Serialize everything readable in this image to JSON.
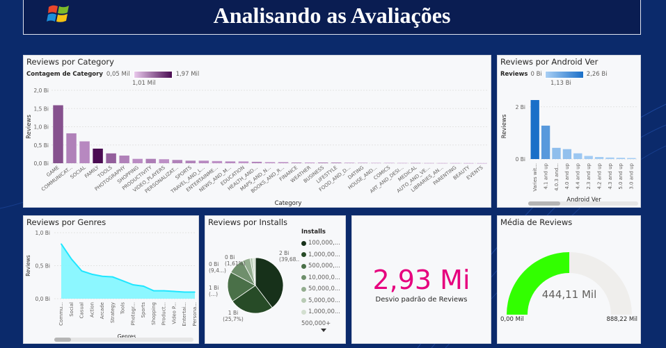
{
  "header": {
    "title": "Analisando as Avaliações"
  },
  "category_card": {
    "title": "Reviews por Category",
    "legend_label": "Contagem de Category",
    "legend_min": "0,05 Mil",
    "legend_max": "1,97 Mil",
    "legend_mid": "1,01 Mil",
    "x_title": "Category",
    "y_title": "Reviews"
  },
  "android_card": {
    "title": "Reviews por Android Ver",
    "legend_label": "Reviews",
    "legend_min": "0 Bi",
    "legend_max": "2,26 Bi",
    "legend_mid": "1,13 Bi",
    "x_title": "Android Ver",
    "y_title": "Reviews"
  },
  "genres_card": {
    "title": "Reviews por Genres",
    "x_title": "Genres",
    "y_title": "Reviews"
  },
  "installs_card": {
    "title": "Reviews por Installs",
    "legend_title": "Installs",
    "legend_more": "500,000+"
  },
  "kpi_card": {
    "value": "2,93 Mi",
    "label": "Desvio padrão de Reviews"
  },
  "gauge_card": {
    "title": "Média de Reviews",
    "value_label": "444,11 Mil",
    "min_label": "0,00 Mil",
    "max_label": "888,22 Mil",
    "value": 444.11,
    "min": 0,
    "max": 888.22,
    "fill_color": "#32ff00",
    "track_color": "#efeeec"
  },
  "chart_data": [
    {
      "type": "bar",
      "title": "Reviews por Category",
      "xlabel": "Category",
      "ylabel": "Reviews",
      "ylim": [
        0,
        2.0
      ],
      "y_ticks": [
        "0,0 Bi",
        "0,5 Bi",
        "1,0 Bi",
        "1,5 Bi",
        "2,0 Bi"
      ],
      "categories": [
        "GAME",
        "COMMUNICAT...",
        "SOCIAL",
        "FAMILY",
        "TOOLS",
        "PHOTOGRAPHY",
        "SHOPPING",
        "PRODUCTIVITY",
        "VIDEO_PLAYERS",
        "PERSONALIZAT...",
        "SPORTS",
        "TRAVEL_AND_L...",
        "ENTERTAINME...",
        "NEWS_AND_M...",
        "EDUCATION",
        "HEALTH_AND...",
        "MAPS_AND_N...",
        "BOOKS_AND_R...",
        "FINANCE",
        "WEATHER",
        "BUSINESS",
        "LIFESTYLE",
        "FOOD_AND_D...",
        "DATING",
        "HOUSE_AND...",
        "COMICS",
        "ART_AND_DESI...",
        "MEDICAL",
        "AUTO_AND_VE...",
        "LIBRARIES_AN...",
        "PARENTING",
        "BEAUTY",
        "EVENTS"
      ],
      "values": [
        1.59,
        0.82,
        0.6,
        0.4,
        0.27,
        0.21,
        0.12,
        0.12,
        0.11,
        0.09,
        0.07,
        0.07,
        0.06,
        0.05,
        0.05,
        0.04,
        0.03,
        0.03,
        0.02,
        0.02,
        0.02,
        0.02,
        0.015,
        0.012,
        0.01,
        0.01,
        0.008,
        0.007,
        0.006,
        0.005,
        0.005,
        0.004,
        0.003
      ],
      "counts": [
        1.05,
        0.4,
        0.3,
        1.97,
        0.85,
        0.4,
        0.25,
        0.45,
        0.2,
        0.4,
        0.4,
        0.3,
        0.2,
        0.3,
        0.15,
        0.35,
        0.2,
        0.25,
        0.4,
        0.1,
        0.45,
        0.4,
        0.15,
        0.25,
        0.1,
        0.08,
        0.07,
        0.5,
        0.1,
        0.1,
        0.07,
        0.06,
        0.05
      ]
    },
    {
      "type": "bar",
      "title": "Reviews por Android Ver",
      "xlabel": "Android Ver",
      "ylabel": "Reviews",
      "ylim": [
        0,
        2.5
      ],
      "y_ticks": [
        "0 Bi",
        "2 Bi"
      ],
      "categories": [
        "Varies wit...",
        "4.1 and up",
        "4.0.3 and...",
        "4.0 and up",
        "4.4 and up",
        "2.3 and up",
        "4.2 and up",
        "4.3 and up",
        "5.0 and up",
        "3.0 and up"
      ],
      "values": [
        2.26,
        1.28,
        0.43,
        0.38,
        0.22,
        0.12,
        0.08,
        0.06,
        0.05,
        0.04
      ]
    },
    {
      "type": "area",
      "title": "Reviews por Genres",
      "xlabel": "Genres",
      "ylabel": "Reviews",
      "ylim": [
        0,
        1.0
      ],
      "y_ticks": [
        "0,0 Bi",
        "0,5 Bi",
        "1,0 Bi"
      ],
      "categories": [
        "Commu...",
        "Social",
        "Casual",
        "Action",
        "Arcade",
        "Strategy",
        "Tools",
        "Photogr...",
        "Sports",
        "Shopping",
        "Product...",
        "Video P...",
        "Entertai...",
        "Persona..."
      ],
      "values": [
        0.83,
        0.6,
        0.42,
        0.37,
        0.34,
        0.33,
        0.27,
        0.21,
        0.19,
        0.12,
        0.12,
        0.11,
        0.1,
        0.1
      ]
    },
    {
      "type": "pie",
      "title": "Reviews por Installs",
      "legend_title": "Installs",
      "series": [
        {
          "name": "100,000,...",
          "value": 39.68,
          "color": "#17311a",
          "label_value": "2 Bi",
          "label_pct": "(39,68...)"
        },
        {
          "name": "1,000,00...",
          "value": 25.7,
          "color": "#274b27",
          "label_value": "1 Bi",
          "label_pct": "(25,7%)"
        },
        {
          "name": "500,000,...",
          "value": 17.5,
          "color": "#4a7048",
          "label_value": "1 Bi",
          "label_pct": "(...)"
        },
        {
          "name": "10,000,0...",
          "value": 9.4,
          "color": "#6f8f6c",
          "label_value": "0 Bi",
          "label_pct": "(9,4...)"
        },
        {
          "name": "50,000,0...",
          "value": 4.6,
          "color": "#93ad8f",
          "label_value": "",
          "label_pct": ""
        },
        {
          "name": "5,000,00...",
          "value": 1.61,
          "color": "#b8cbb5",
          "label_value": "0 Bi",
          "label_pct": "(1,61%)"
        },
        {
          "name": "1,000,00...",
          "value": 1.51,
          "color": "#d3dfd0",
          "label_value": "",
          "label_pct": ""
        }
      ]
    }
  ]
}
